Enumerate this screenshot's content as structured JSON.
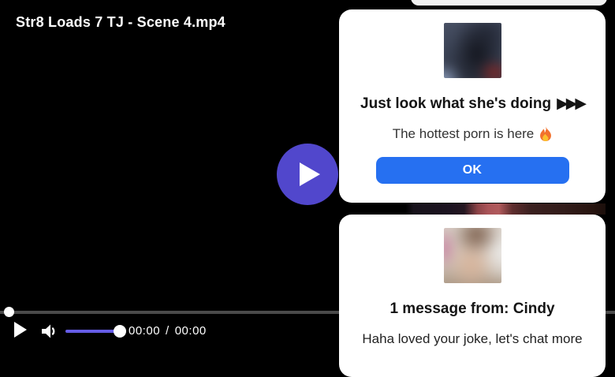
{
  "player": {
    "title": "Str8 Loads 7 TJ - Scene 4.mp4",
    "current_time": "00:00",
    "time_separator": "/",
    "duration": "00:00"
  },
  "colors": {
    "play_button_accent": "#5147cc",
    "volume_accent": "#655ce6",
    "ok_button": "#2670f1",
    "progress_track": "#4a4a4a",
    "popup_background": "#ffffff"
  },
  "icons": {
    "big_play": "play-triangle",
    "ctrl_play": "play-triangle",
    "volume": "speaker-low",
    "heading_arrows": "▶▶▶",
    "fire": "🔥"
  },
  "popup_offer": {
    "heading": "Just look what she's doing",
    "subtext": "The hottest porn is here",
    "ok_label": "OK"
  },
  "popup_message": {
    "heading": "1 message from: Cindy",
    "body": "Haha loved your joke, let's chat more"
  }
}
